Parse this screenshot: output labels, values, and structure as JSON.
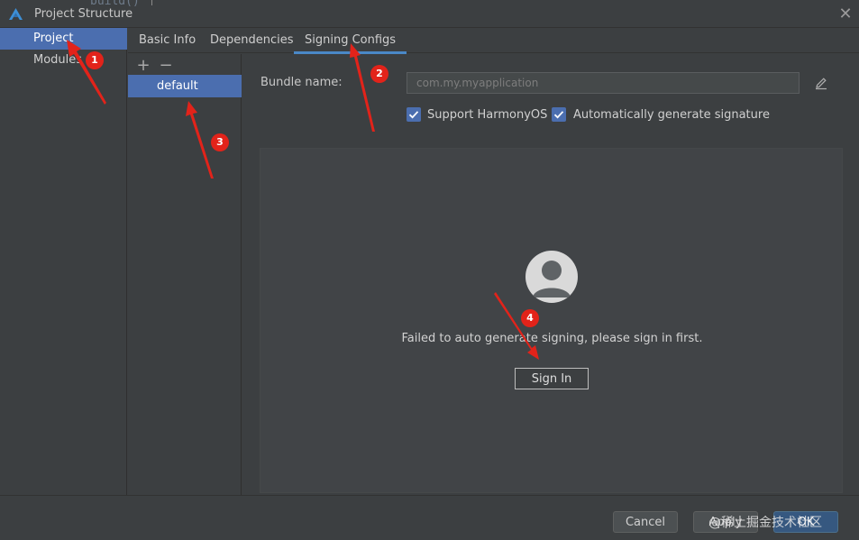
{
  "window": {
    "title": "Project Structure",
    "background_code": "build()",
    "close_icon": "close-icon"
  },
  "nav": {
    "items": [
      {
        "label": "Project",
        "selected": true
      },
      {
        "label": "Modules",
        "selected": false
      }
    ]
  },
  "tabs": [
    {
      "label": "Basic Info",
      "active": false
    },
    {
      "label": "Dependencies",
      "active": false
    },
    {
      "label": "Signing Configs",
      "active": true
    }
  ],
  "signing_configs": {
    "add_label": "+",
    "remove_label": "−",
    "items": [
      {
        "label": "default",
        "selected": true
      }
    ]
  },
  "form": {
    "bundle_label": "Bundle name:",
    "bundle_value": "com.my.myapplication",
    "support_harmony": {
      "label": "Support HarmonyOS",
      "checked": true
    },
    "auto_sign": {
      "label": "Automatically generate signature",
      "checked": true
    }
  },
  "signin": {
    "message": "Failed to auto generate signing, please sign in first.",
    "button": "Sign In"
  },
  "footer": {
    "cancel": "Cancel",
    "apply": "Apply",
    "ok": "OK"
  },
  "watermark": "@稀土掘金技术社区",
  "annotations": [
    "1",
    "2",
    "3",
    "4"
  ],
  "colors": {
    "accent": "#4b6eaf",
    "tab_underline": "#4a88c7",
    "annotation_red": "#e2231a",
    "primary_button": "#365880"
  }
}
